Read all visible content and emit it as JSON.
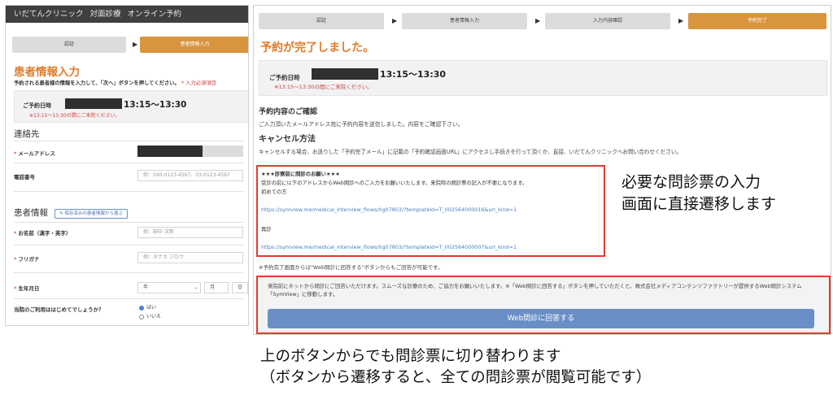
{
  "left": {
    "topbar": [
      "いだてんクリニック",
      "対面診療",
      "オンライン予約"
    ],
    "steps": [
      "認証",
      "患者情報入力"
    ],
    "title": "患者情報入力",
    "intro": "予約される患者様の情報を入力して、「次へ」ボタンを押してください。",
    "intro_note": "* 入力必須項目",
    "reservation": {
      "label": "ご予約日時",
      "time": "13:15〜13:30",
      "warning": "※13:15〜13:30の間にご来院ください。"
    },
    "contact_heading": "連絡先",
    "email_label": "メールアドレス",
    "phone_label": "電話番号",
    "phone_placeholder": "例：090-0123-4567、03-0123-4567",
    "patient_heading": "患者情報",
    "copy_button": "保存済みの患者情報から選ぶ",
    "name_label": "お名前（漢字・英字）",
    "name_placeholder": "例：田中 次郎",
    "kana_label": "フリガナ",
    "kana_placeholder": "例：タナカ ジロウ",
    "birth_label": "生年月日",
    "birth_year": "年",
    "birth_month": "月",
    "birth_day": "日",
    "first_visit_question": "当院のご利用ははじめてでしょうか？",
    "radio_yes": "はい",
    "radio_no": "いいえ"
  },
  "right": {
    "steps": [
      "認証",
      "患者情報入力",
      "入力内容確認",
      "予約完了"
    ],
    "title": "予約が完了しました。",
    "reservation": {
      "label": "ご予約日時",
      "time": "13:15〜13:30",
      "warning": "※13:15〜13:30の間にご来院ください。"
    },
    "confirm_heading": "予約内容のご確認",
    "confirm_text": "ご入力頂いたメールアドレス宛に予約内容を送信しました。内容をご確認下さい。",
    "cancel_heading": "キャンセル方法",
    "cancel_text": "キャンセルする場合、お送りした「予約完了メール」に記載の「予約確認画面URL」にアクセスし手続きを行って頂くか、直接、いだてんクリニックへお問い合わせください。",
    "request_title": "★★★診察前に問診のお願い★★★",
    "request_text": "受診の前に以下のアドレスからWeb問診へのご入力をお願いいたします。来院時の問診票の記入が不要になります。",
    "first_label": "初めての方",
    "first_url": "https://symview.me/medical_interview_flows/hg07803/?templateid=T_002564000016&url_kind=1",
    "revisit_label": "再診",
    "revisit_url": "https://symview.me/medical_interview_flows/hg07803/?templateid=T_002564000007&url_kind=1",
    "footnote": "※予約完了画面からは\"Web問診に回答する\"ボタンからもご回答が可能です。",
    "web_text": "来院前にネットから問診にご回答いただけます。スムーズな診療のため、ご協力をお願いいたします。※「Web問診に回答する」ボタンを押していただくと、株式会社メディアコンテンツファクトリーが提供するWeb問診システム「SymView」に移動します。",
    "web_button": "Web問診に回答する"
  },
  "annotations": {
    "side_line1": "必要な問診票の入力",
    "side_line2": "画面に直接遷移します",
    "bottom_line1": "上のボタンからでも問診票に切り替わります",
    "bottom_line2": "（ボタンから遷移すると、全ての問診票が閲覧可能です）"
  }
}
